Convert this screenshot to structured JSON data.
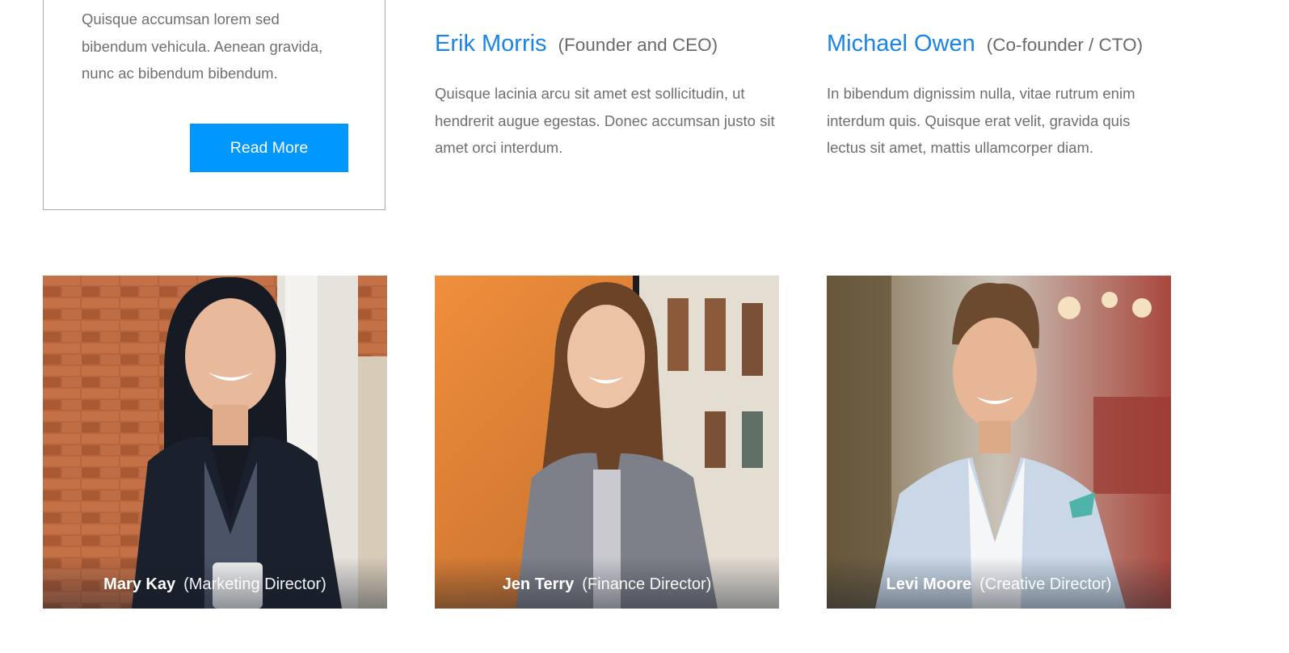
{
  "intro_card": {
    "text": "Quisque accumsan lorem sed bibendum vehicula. Aenean gravida, nunc ac bibendum bibendum.",
    "button_label": "Read More",
    "button_color": "#0098ff"
  },
  "leaders": [
    {
      "name": "Erik Morris",
      "role": "(Founder and CEO)",
      "description": "Quisque lacinia arcu sit amet est sollicitudin, ut hendrerit augue egestas. Donec accumsan justo sit amet orci interdum."
    },
    {
      "name": "Michael Owen",
      "role": "(Co-founder / CTO)",
      "description": "In bibendum dignissim nulla, vitae rutrum enim interdum quis. Quisque erat velit, gravida quis lectus sit amet, mattis ullamcorper diam."
    }
  ],
  "team": [
    {
      "name": "Mary Kay",
      "role": "(Marketing Director)",
      "photo": "portrait-woman-brick-wall"
    },
    {
      "name": "Jen Terry",
      "role": "(Finance Director)",
      "photo": "portrait-woman-orange-wall"
    },
    {
      "name": "Levi Moore",
      "role": "(Creative Director)",
      "photo": "portrait-man-restaurant"
    }
  ],
  "colors": {
    "accent_name": "#1a85e6",
    "text": "#6f6f6f",
    "card_border": "#a9a9a9"
  }
}
